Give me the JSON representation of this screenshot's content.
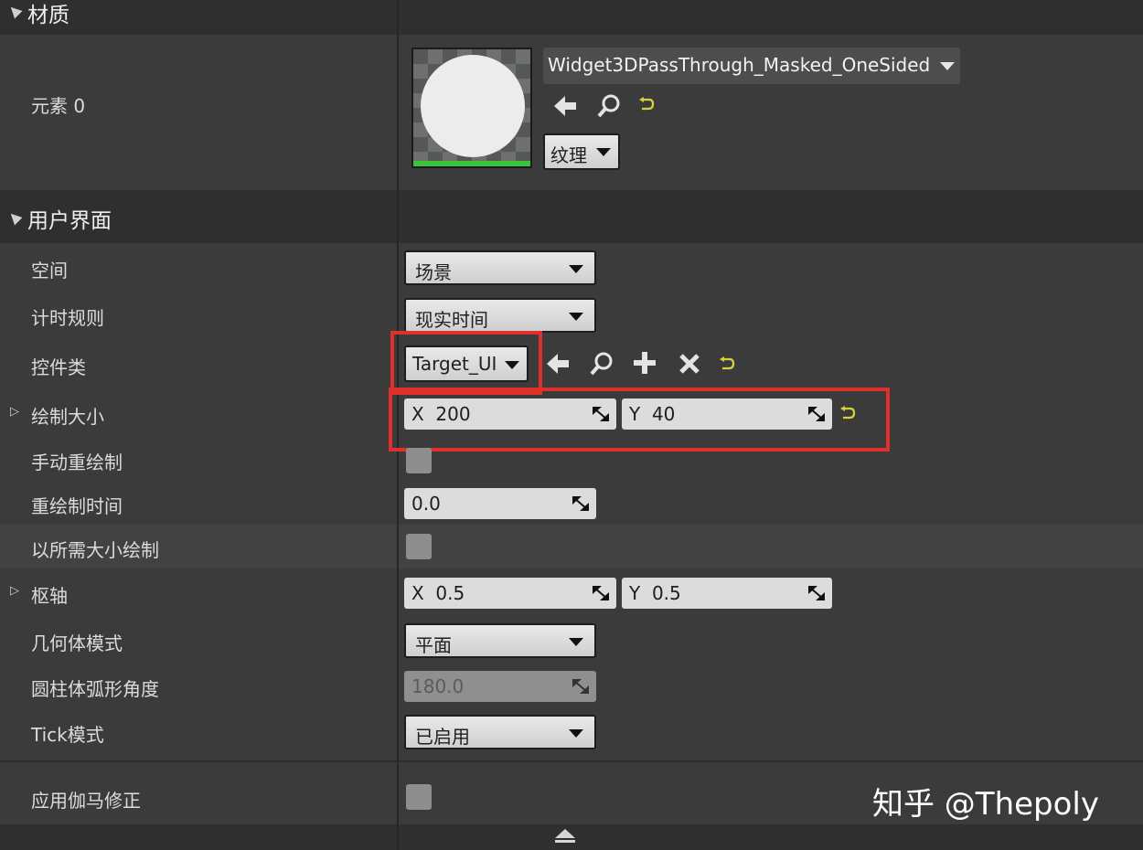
{
  "categories": {
    "material": "材质",
    "user_interface": "用户界面"
  },
  "material": {
    "element_label": "元素 0",
    "material_name": "Widget3DPassThrough_Masked_OneSided",
    "texture_button": "纹理"
  },
  "properties": {
    "space": {
      "label": "空间",
      "value": "场景"
    },
    "timing": {
      "label": "计时规则",
      "value": "现实时间"
    },
    "widget_class": {
      "label": "控件类",
      "value": "Target_UI"
    },
    "draw_size": {
      "label": "绘制大小",
      "x_axis": "X",
      "x": "200",
      "y_axis": "Y",
      "y": "40"
    },
    "manual_redraw": {
      "label": "手动重绘制",
      "checked": false
    },
    "redraw_time": {
      "label": "重绘制时间",
      "value": "0.0"
    },
    "draw_at_desired_size": {
      "label": "以所需大小绘制",
      "checked": false
    },
    "pivot": {
      "label": "枢轴",
      "x_axis": "X",
      "x": "0.5",
      "y_axis": "Y",
      "y": "0.5"
    },
    "geometry_mode": {
      "label": "几何体模式",
      "value": "平面"
    },
    "cylinder_arc_angle": {
      "label": "圆柱体弧形角度",
      "value": "180.0"
    },
    "tick_mode": {
      "label": "Tick模式",
      "value": "已启用"
    },
    "apply_gamma_correction": {
      "label": "应用伽马修正",
      "checked": false
    }
  },
  "watermark": "知乎 @Thepoly",
  "colors": {
    "highlight": "#e0302c",
    "reset_arrow": "#d8d23a"
  }
}
